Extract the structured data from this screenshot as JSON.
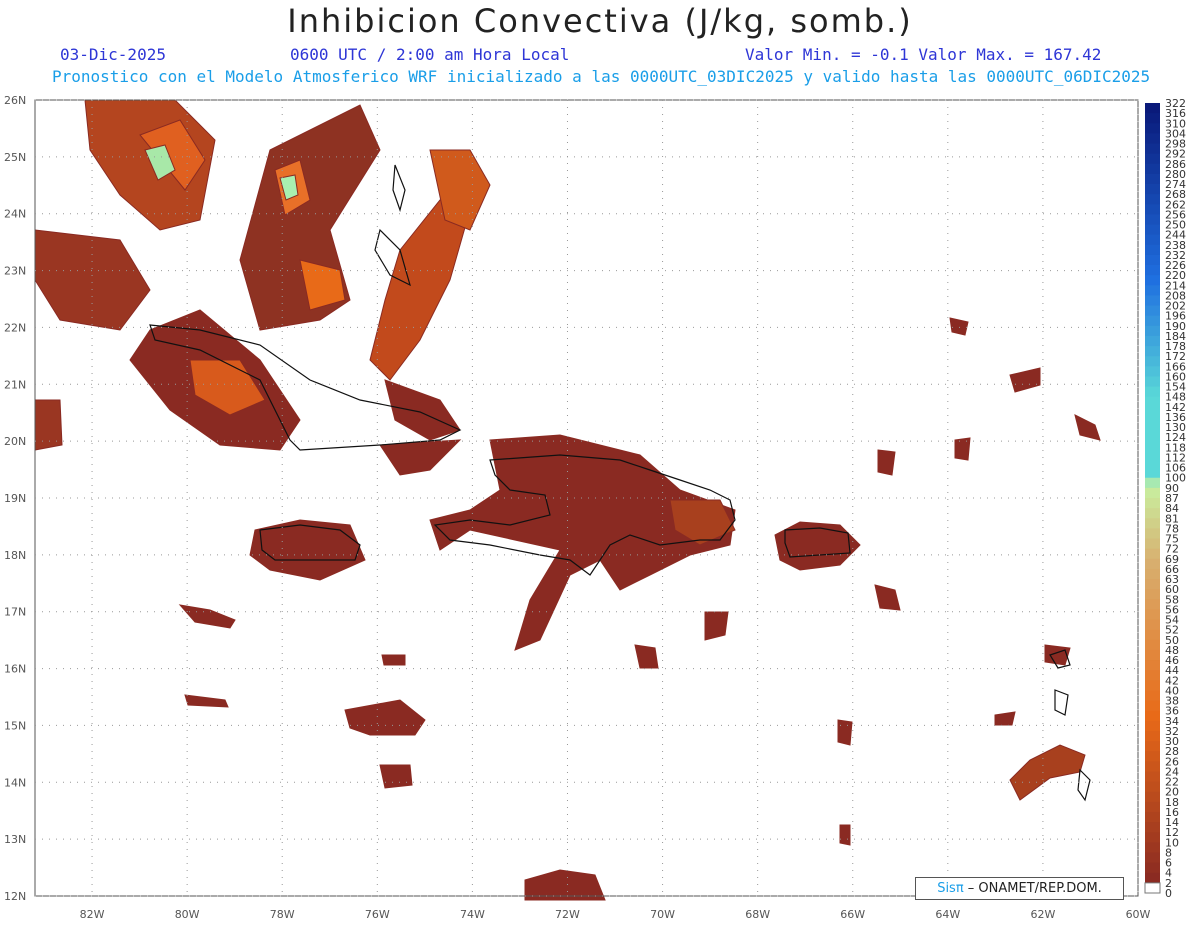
{
  "header": {
    "title": "Inhibicion Convectiva (J/kg, somb.)",
    "date": "03-Dic-2025",
    "time": "0600 UTC / 2:00 am Hora Local",
    "minmax": "Valor Min. = -0.1  Valor Max. = 167.42",
    "subtitle": "Pronostico con el Modelo Atmosferico WRF inicializado a las 0000UTC_03DIC2025 y valido hasta las  0000UTC_06DIC2025"
  },
  "map": {
    "lat_labels": [
      "26N",
      "25N",
      "24N",
      "23N",
      "22N",
      "21N",
      "20N",
      "19N",
      "18N",
      "17N",
      "16N",
      "15N",
      "14N",
      "13N",
      "12N"
    ],
    "lon_labels": [
      "82W",
      "80W",
      "78W",
      "76W",
      "74W",
      "72W",
      "70W",
      "68W",
      "66W",
      "64W",
      "62W",
      "60W"
    ],
    "lat_range": [
      12,
      26
    ],
    "lon_range": [
      -83.2,
      -60
    ],
    "grid": "dotted"
  },
  "colorbar": {
    "labels": [
      "322",
      "316",
      "310",
      "304",
      "298",
      "292",
      "286",
      "280",
      "274",
      "268",
      "262",
      "256",
      "250",
      "244",
      "238",
      "232",
      "226",
      "220",
      "214",
      "208",
      "202",
      "196",
      "190",
      "184",
      "178",
      "172",
      "166",
      "160",
      "154",
      "148",
      "142",
      "136",
      "130",
      "124",
      "118",
      "112",
      "106",
      "100",
      "90",
      "87",
      "84",
      "81",
      "78",
      "75",
      "72",
      "69",
      "66",
      "63",
      "60",
      "58",
      "56",
      "54",
      "52",
      "50",
      "48",
      "46",
      "44",
      "42",
      "40",
      "38",
      "36",
      "34",
      "32",
      "30",
      "28",
      "26",
      "24",
      "22",
      "20",
      "18",
      "16",
      "14",
      "12",
      "10",
      "8",
      "6",
      "4",
      "2",
      "0"
    ],
    "colors": {
      "dark_blue": "#0a1a7a",
      "blue": "#1f6fe0",
      "cyan": "#5ad8d8",
      "pale_green": "#c8f0a0",
      "tan": "#d8b070",
      "orange": "#e86a18",
      "dark_red": "#8a2a22"
    }
  },
  "credit": {
    "brand": "Sisπ",
    "text": " – ONAMET/REP.DOM."
  }
}
